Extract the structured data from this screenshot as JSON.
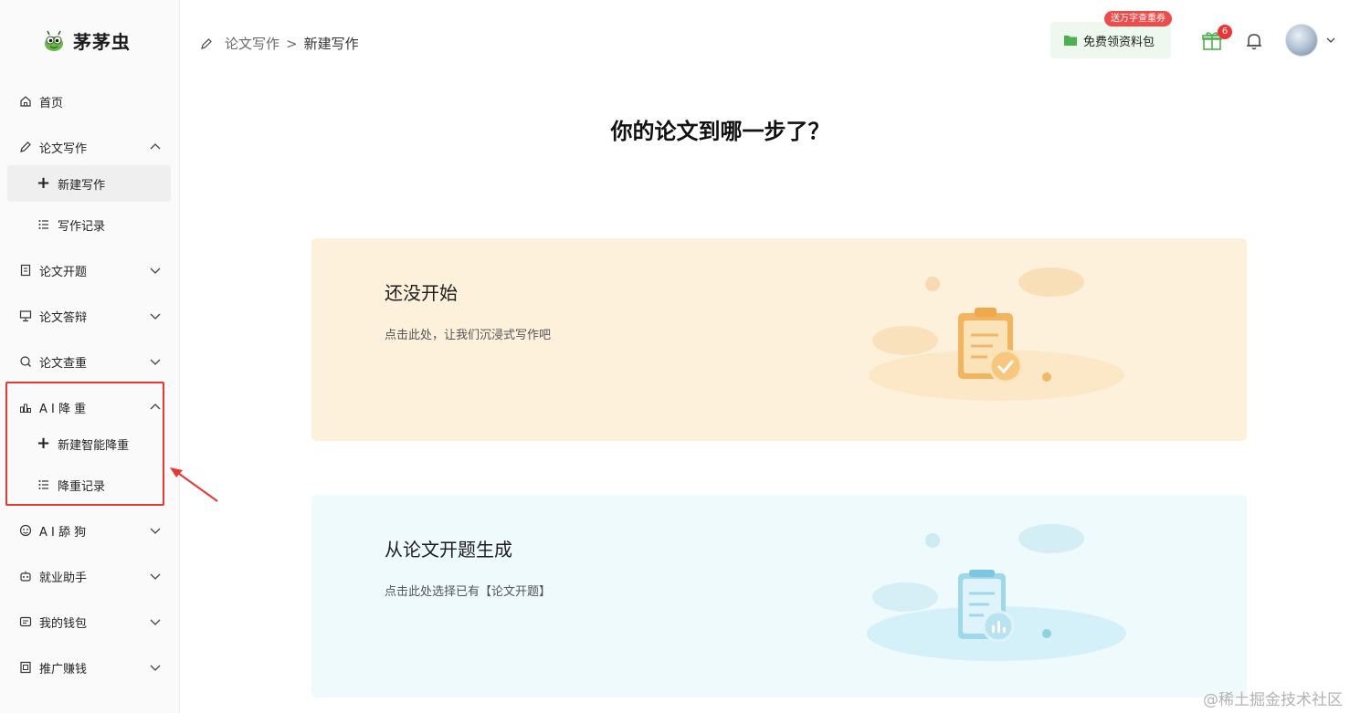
{
  "sidebar": {
    "brand": "茅茅虫",
    "items": [
      {
        "label": "首页",
        "icon": "home-icon"
      },
      {
        "label": "论文写作",
        "icon": "pen-icon"
      },
      {
        "label": "新建写作"
      },
      {
        "label": "写作记录",
        "icon": "list-icon"
      },
      {
        "label": "论文开题",
        "icon": "doc-icon"
      },
      {
        "label": "论文答辩",
        "icon": "presentation-icon"
      },
      {
        "label": "论文查重",
        "icon": "search-icon"
      },
      {
        "label": "A I 降 重",
        "icon": "chart-icon"
      },
      {
        "label": "新建智能降重"
      },
      {
        "label": "降重记录",
        "icon": "list-icon"
      },
      {
        "label": "A I 舔 狗",
        "icon": "face-icon"
      },
      {
        "label": "就业助手",
        "icon": "robot-icon"
      },
      {
        "label": "我的钱包",
        "icon": "wallet-icon"
      },
      {
        "label": "推广赚钱",
        "icon": "promo-icon"
      }
    ]
  },
  "header": {
    "breadcrumb": {
      "parent": "论文写作",
      "separator": ">",
      "current": "新建写作"
    },
    "resource_button": "免费领资料包",
    "promo_badge": "送万字查重券",
    "gift_count": "6"
  },
  "main": {
    "title": "你的论文到哪一步了？",
    "cards": [
      {
        "title": "还没开始",
        "desc": "点击此处，让我们沉浸式写作吧"
      },
      {
        "title": "从论文开题生成",
        "desc": "点击此处选择已有【论文开题】"
      }
    ]
  },
  "watermark": "@稀土掘金技术社区",
  "colors": {
    "accent_red": "#e53935",
    "card_warm": "#fdf1dc",
    "card_cool": "#eefafc",
    "green": "#4caf50"
  }
}
